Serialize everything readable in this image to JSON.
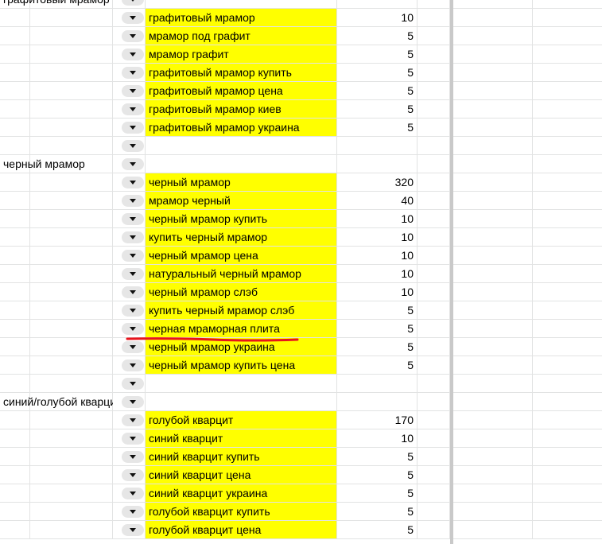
{
  "sheet": {
    "categories": [
      {
        "label": "графитовый мрамор",
        "rows": [
          {
            "keyword": "графитовый мрамор",
            "volume": "10"
          },
          {
            "keyword": "мрамор под графит",
            "volume": "5"
          },
          {
            "keyword": "мрамор графит",
            "volume": "5"
          },
          {
            "keyword": "графитовый мрамор купить",
            "volume": "5"
          },
          {
            "keyword": "графитовый мрамор цена",
            "volume": "5"
          },
          {
            "keyword": "графитовый мрамор киев",
            "volume": "5"
          },
          {
            "keyword": "графитовый мрамор украина",
            "volume": "5"
          }
        ]
      },
      {
        "label": "черный мрамор",
        "rows": [
          {
            "keyword": "черный мрамор",
            "volume": "320"
          },
          {
            "keyword": "мрамор черный",
            "volume": "40"
          },
          {
            "keyword": "черный мрамор купить",
            "volume": "10"
          },
          {
            "keyword": "купить черный мрамор",
            "volume": "10"
          },
          {
            "keyword": "черный мрамор цена",
            "volume": "10"
          },
          {
            "keyword": "натуральный черный мрамор",
            "volume": "10"
          },
          {
            "keyword": "черный мрамор слэб",
            "volume": "10"
          },
          {
            "keyword": "купить черный мрамор слэб",
            "volume": "5"
          },
          {
            "keyword": "черная мраморная плита",
            "volume": "5",
            "struck": true
          },
          {
            "keyword": "черный мрамор украина",
            "volume": "5"
          },
          {
            "keyword": "черный мрамор купить цена",
            "volume": "5"
          }
        ]
      },
      {
        "label": "синий/голубой кварцит",
        "rows": [
          {
            "keyword": "голубой кварцит",
            "volume": "170"
          },
          {
            "keyword": "синий кварцит",
            "volume": "10"
          },
          {
            "keyword": "синий кварцит купить",
            "volume": "5"
          },
          {
            "keyword": "синий кварцит цена",
            "volume": "5"
          },
          {
            "keyword": "синий кварцит украина",
            "volume": "5"
          },
          {
            "keyword": "голубой кварцит купить",
            "volume": "5"
          },
          {
            "keyword": "голубой кварцит цена",
            "volume": "5"
          }
        ]
      }
    ],
    "colors": {
      "highlight": "#ffff00",
      "gridline": "#e2e3e3",
      "dropdown_chip": "#e6e6e6",
      "strike_mark": "#e8141c",
      "freeze_bar": "#c9c9c9"
    },
    "icons": {
      "dropdown": "chevron-down-icon"
    }
  }
}
